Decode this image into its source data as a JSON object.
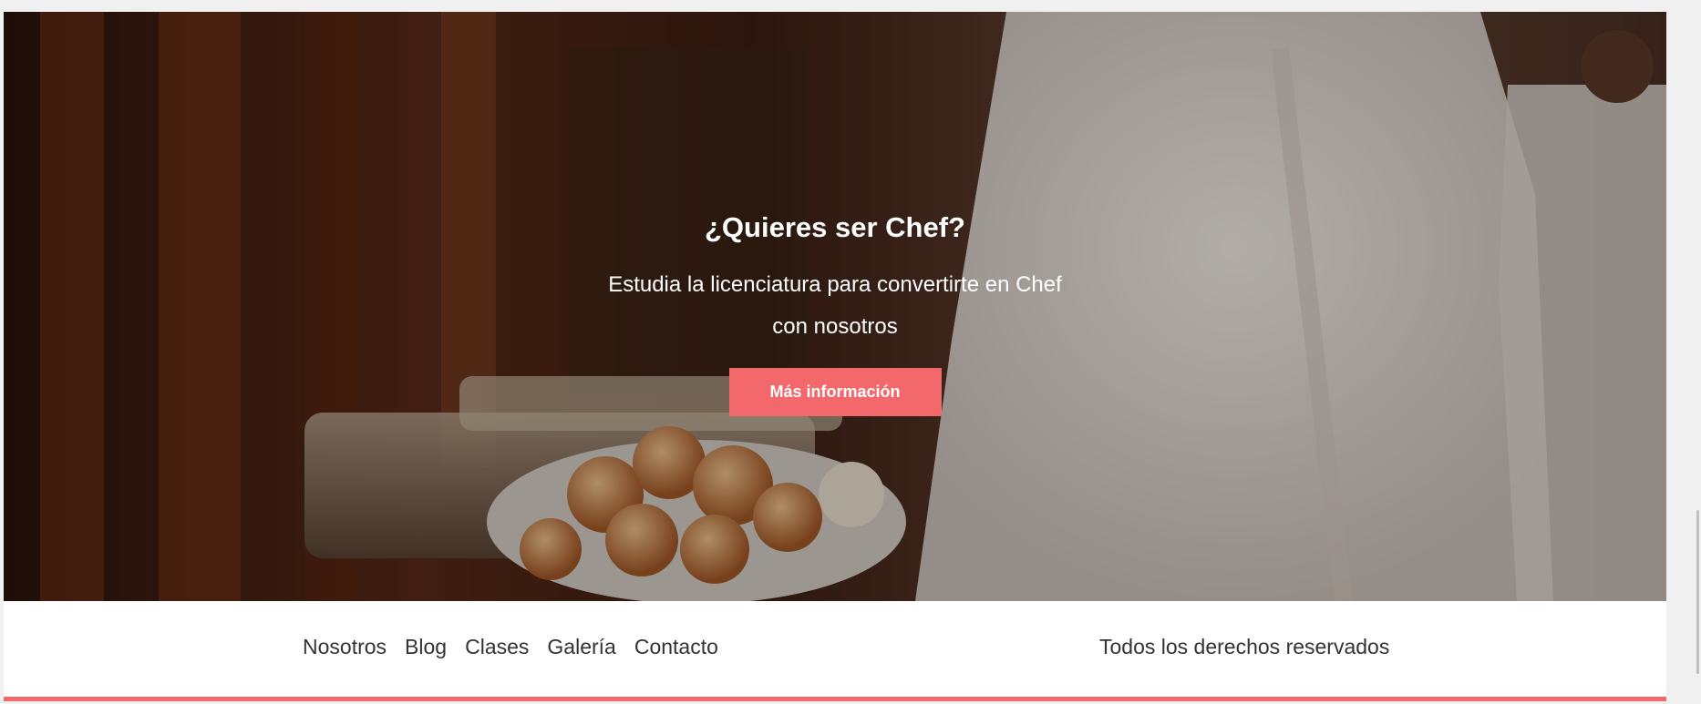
{
  "hero": {
    "title": "¿Quieres ser Chef?",
    "subtitle": "Estudia la licenciatura para convertirte en Chef con nosotros",
    "button_label": "Más información",
    "accent_color": "#f2686b",
    "image": "chef-with-bread-basket-photo"
  },
  "footer": {
    "nav": [
      {
        "label": "Nosotros"
      },
      {
        "label": "Blog"
      },
      {
        "label": "Clases"
      },
      {
        "label": "Galería"
      },
      {
        "label": "Contacto"
      }
    ],
    "copyright": "Todos los derechos reservados",
    "bar_color": "#f2686b"
  }
}
